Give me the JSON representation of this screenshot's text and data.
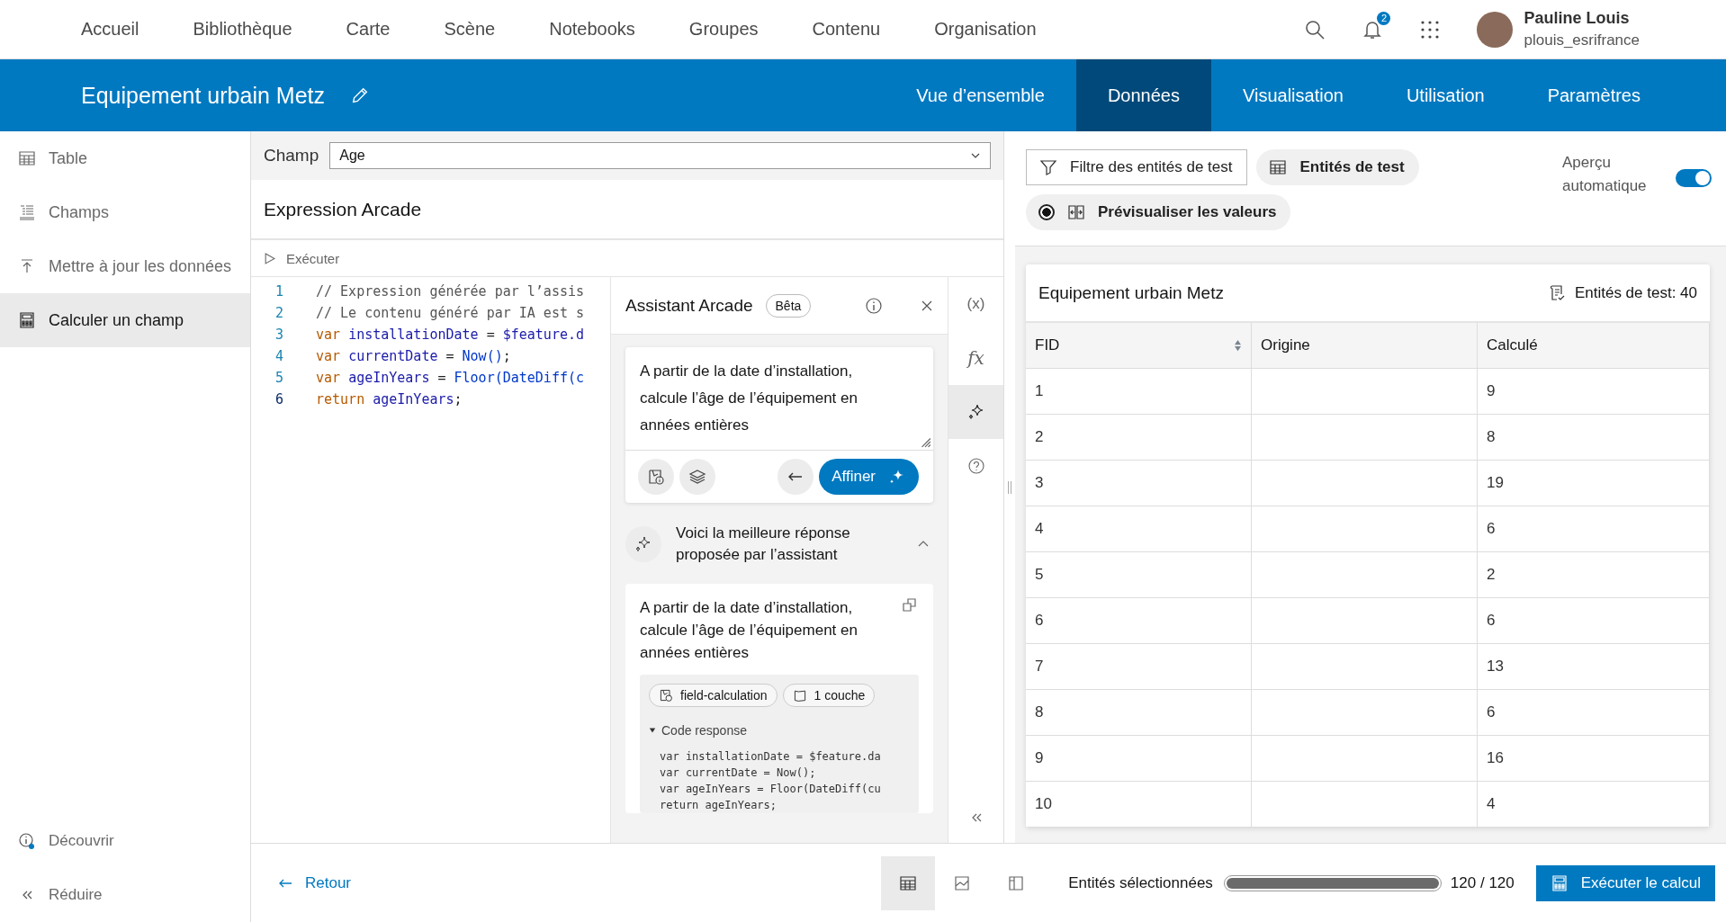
{
  "top_nav": {
    "items": [
      "Accueil",
      "Bibliothèque",
      "Carte",
      "Scène",
      "Notebooks",
      "Groupes",
      "Contenu",
      "Organisation"
    ],
    "notifications": "2",
    "user": {
      "name": "Pauline Louis",
      "username": "plouis_esrifrance"
    }
  },
  "item_bar": {
    "title": "Equipement urbain Metz",
    "tabs": [
      {
        "label": "Vue d’ensemble",
        "selected": false
      },
      {
        "label": "Données",
        "selected": true
      },
      {
        "label": "Visualisation",
        "selected": false
      },
      {
        "label": "Utilisation",
        "selected": false
      },
      {
        "label": "Paramètres",
        "selected": false
      }
    ]
  },
  "sidebar": {
    "items": [
      {
        "label": "Table",
        "selected": false
      },
      {
        "label": "Champs",
        "selected": false
      },
      {
        "label": "Mettre à jour les données",
        "selected": false
      },
      {
        "label": "Calculer un champ",
        "selected": true
      }
    ],
    "footer": [
      "Découvrir",
      "Réduire"
    ]
  },
  "field": {
    "label": "Champ",
    "value": "Age"
  },
  "editor": {
    "title": "Expression Arcade",
    "run_label": "Exécuter",
    "lines": [
      {
        "number": "1",
        "active": false,
        "tokens": [
          {
            "kind": "comment",
            "text": "// Expression générée par l’assis"
          }
        ]
      },
      {
        "number": "2",
        "active": false,
        "tokens": [
          {
            "kind": "comment",
            "text": "// Le contenu généré par IA est s"
          }
        ]
      },
      {
        "number": "3",
        "active": false,
        "tokens": [
          {
            "kind": "keyword",
            "text": "var "
          },
          {
            "kind": "ident",
            "text": "installationDate"
          },
          {
            "kind": "plain",
            "text": " = "
          },
          {
            "kind": "ident",
            "text": "$feature.d"
          }
        ]
      },
      {
        "number": "4",
        "active": false,
        "tokens": [
          {
            "kind": "keyword",
            "text": "var "
          },
          {
            "kind": "ident",
            "text": "currentDate"
          },
          {
            "kind": "plain",
            "text": " = "
          },
          {
            "kind": "func",
            "text": "Now()"
          },
          {
            "kind": "plain",
            "text": ";"
          }
        ]
      },
      {
        "number": "5",
        "active": false,
        "tokens": [
          {
            "kind": "keyword",
            "text": "var "
          },
          {
            "kind": "ident",
            "text": "ageInYears"
          },
          {
            "kind": "plain",
            "text": " = "
          },
          {
            "kind": "func",
            "text": "Floor(DateDiff(c"
          }
        ]
      },
      {
        "number": "6",
        "active": true,
        "tokens": [
          {
            "kind": "keyword",
            "text": "return "
          },
          {
            "kind": "ident",
            "text": "ageInYears"
          },
          {
            "kind": "plain",
            "text": ";"
          }
        ]
      }
    ]
  },
  "assistant": {
    "title": "Assistant Arcade",
    "badge": "Bêta",
    "prompt": "A partir de la date d’installation, calcule l’âge de l’équipement en années entières",
    "refine_label": "Affiner",
    "response_header": "Voici la meilleure réponse proposée par l’assistant",
    "expanded": true,
    "response": {
      "question": "A partir de la date d’installation, calcule l’âge de l’équipement en années entières",
      "tags": [
        "field-calculation",
        "1 couche"
      ],
      "code_label": "Code response",
      "code_lines": [
        "var installationDate = $feature.da",
        "var currentDate = Now();",
        "var ageInYears = Floor(DateDiff(cu",
        "return ageInYears;"
      ]
    }
  },
  "tool_strip": [
    {
      "kind": "text",
      "label": "(x)",
      "selected": false
    },
    {
      "kind": "text",
      "label": "fx",
      "selected": false
    },
    {
      "kind": "sparkle",
      "selected": true
    },
    {
      "kind": "help",
      "selected": false
    }
  ],
  "preview": {
    "filter_label": "Filtre des entités de test",
    "test_features_label": "Entités de test",
    "preview_values": {
      "label": "Prévisualiser les valeurs",
      "checked": true
    },
    "auto_preview": {
      "label": "Aperçu automatique",
      "on": true
    }
  },
  "table": {
    "title": "Equipement urbain Metz",
    "count": "Entités de test: 40",
    "columns": [
      "FID",
      "Origine",
      "Calculé"
    ],
    "rows": [
      {
        "fid": "1",
        "calculated": "9"
      },
      {
        "fid": "2",
        "calculated": "8"
      },
      {
        "fid": "3",
        "calculated": "19"
      },
      {
        "fid": "4",
        "calculated": "6"
      },
      {
        "fid": "5",
        "calculated": "2"
      },
      {
        "fid": "6",
        "calculated": "6"
      },
      {
        "fid": "7",
        "calculated": "13"
      },
      {
        "fid": "8",
        "calculated": "6"
      },
      {
        "fid": "9",
        "calculated": "16"
      },
      {
        "fid": "10",
        "calculated": "4"
      }
    ]
  },
  "footer": {
    "back_label": "Retour",
    "views": [
      {
        "selected": true
      },
      {
        "selected": false
      },
      {
        "selected": false
      }
    ],
    "selected_label": "Entités sélectionnées",
    "progress": {
      "level": 1
    },
    "progress_text": "120 / 120",
    "run_label": "Exécuter le calcul"
  }
}
